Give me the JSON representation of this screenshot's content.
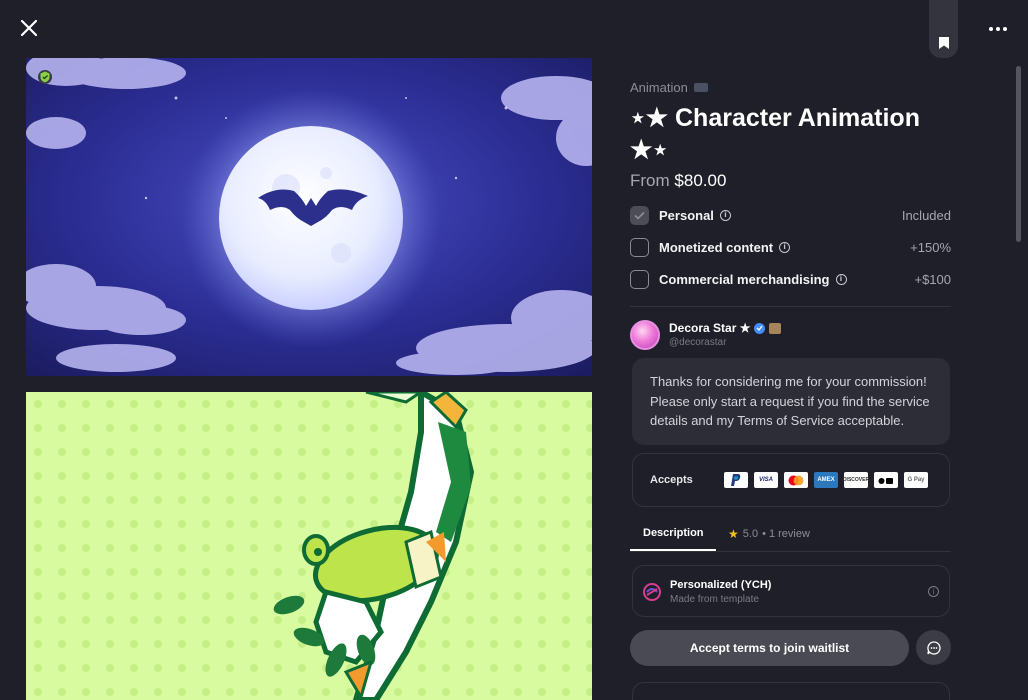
{
  "listing": {
    "category": "Animation",
    "title": "⋆★ Character Animation ★⋆",
    "price_prefix": "From",
    "price": "$80.00"
  },
  "license_options": [
    {
      "label": "Personal",
      "value": "Included",
      "checked": true
    },
    {
      "label": "Monetized content",
      "value": "+150%",
      "checked": false
    },
    {
      "label": "Commercial merchandising",
      "value": "+$100",
      "checked": false
    }
  ],
  "creator": {
    "name": "Decora Star ★",
    "handle": "@decorastar",
    "message": "Thanks for considering me for your commission! Please only start a request if you find the service details and my Terms of Service acceptable."
  },
  "payments": {
    "label": "Accepts",
    "methods": [
      "PayPal",
      "VISA",
      "Mastercard",
      "AMEX",
      "DISCOVER",
      "Apple Pay",
      "G Pay"
    ]
  },
  "tabs": {
    "description": "Description",
    "rating": "5.0",
    "reviews": "• 1 review"
  },
  "service_type": {
    "title": "Personalized (YCH)",
    "subtitle": "Made from template"
  },
  "cta": {
    "label": "Accept terms to join waitlist"
  },
  "icons": {
    "close": "close-icon",
    "bookmark": "bookmark-icon",
    "more": "more-icon",
    "message": "chat-icon"
  },
  "colors": {
    "background": "#1f1f29",
    "card": "#2d2d37",
    "button": "#4a4a54",
    "verified_blue": "#3f8dff",
    "rating_star": "#f4c01e"
  }
}
